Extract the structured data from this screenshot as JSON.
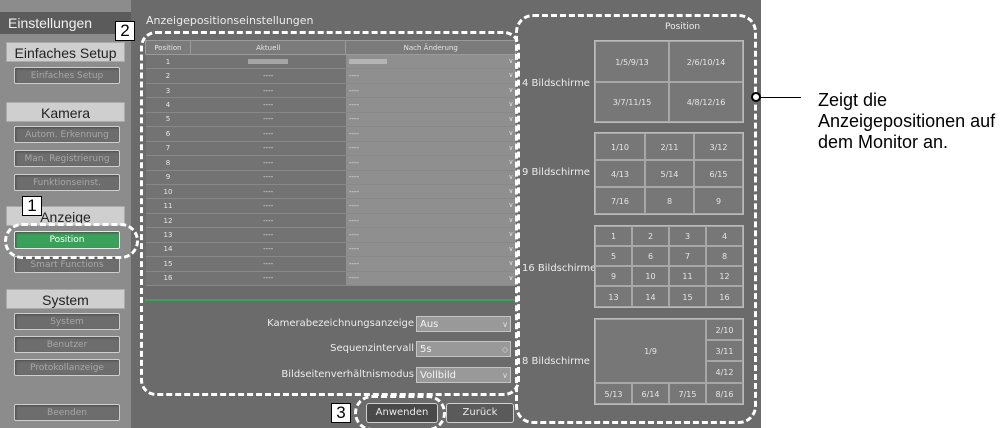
{
  "sidebar": {
    "header": "Einstellungen",
    "sections": [
      {
        "title": "Einfaches Setup",
        "items": [
          "Einfaches Setup"
        ]
      },
      {
        "title": "Kamera",
        "items": [
          "Autom. Erkennung",
          "Man. Registrierung",
          "Funktionseinst."
        ]
      },
      {
        "title": "Anzeige",
        "items": [
          "Position",
          "Smart Functions"
        ]
      },
      {
        "title": "System",
        "items": [
          "System",
          "Benutzer",
          "Protokollanzeige"
        ]
      }
    ],
    "active_item": "Position",
    "exit_label": "Beenden"
  },
  "main": {
    "title": "Anzeigepositionseinstellungen",
    "table": {
      "headers": [
        "Position",
        "Aktuell",
        "Nach Änderung"
      ],
      "rows": [
        {
          "pos": "1",
          "current": "",
          "after": ""
        },
        {
          "pos": "2",
          "current": "----",
          "after": "----"
        },
        {
          "pos": "3",
          "current": "----",
          "after": "----"
        },
        {
          "pos": "4",
          "current": "----",
          "after": "----"
        },
        {
          "pos": "5",
          "current": "----",
          "after": "----"
        },
        {
          "pos": "6",
          "current": "----",
          "after": "----"
        },
        {
          "pos": "7",
          "current": "----",
          "after": "----"
        },
        {
          "pos": "8",
          "current": "----",
          "after": "----"
        },
        {
          "pos": "9",
          "current": "----",
          "after": "----"
        },
        {
          "pos": "10",
          "current": "----",
          "after": "----"
        },
        {
          "pos": "11",
          "current": "----",
          "after": "----"
        },
        {
          "pos": "12",
          "current": "----",
          "after": "----"
        },
        {
          "pos": "13",
          "current": "----",
          "after": "----"
        },
        {
          "pos": "14",
          "current": "----",
          "after": "----"
        },
        {
          "pos": "15",
          "current": "----",
          "after": "----"
        },
        {
          "pos": "16",
          "current": "----",
          "after": "----"
        }
      ]
    },
    "options": [
      {
        "label": "Kamerabezeichnungsanzeige",
        "value": "Aus"
      },
      {
        "label": "Sequenzintervall",
        "value": "5s"
      },
      {
        "label": "Bildseitenverhältnismodus",
        "value": "Vollbild"
      }
    ],
    "apply_label": "Anwenden",
    "back_label": "Zurück"
  },
  "position_panel": {
    "title": "Position",
    "groups": [
      {
        "label": "4 Bildschirme",
        "cells": [
          "1/5/9/13",
          "2/6/10/14",
          "3/7/11/15",
          "4/8/12/16"
        ]
      },
      {
        "label": "9 Bildschirme",
        "cells": [
          "1/10",
          "2/11",
          "3/12",
          "4/13",
          "5/14",
          "6/15",
          "7/16",
          "8",
          "9"
        ]
      },
      {
        "label": "16 Bildschirme",
        "cells": [
          "1",
          "2",
          "3",
          "4",
          "5",
          "6",
          "7",
          "8",
          "9",
          "10",
          "11",
          "12",
          "13",
          "14",
          "15",
          "16"
        ]
      },
      {
        "label": "8 Bildschirme",
        "cells": [
          "1/9",
          "2/10",
          "3/11",
          "4/12",
          "5/13",
          "6/14",
          "7/15",
          "8/16"
        ]
      }
    ]
  },
  "annotations": {
    "markers": [
      "1",
      "2",
      "3"
    ],
    "callout": "Zeigt die Anzeigepositionen auf dem Monitor an."
  },
  "icons": {
    "dropdown": "chevron-down-icon",
    "spinner": "spinner-arrows-icon"
  }
}
